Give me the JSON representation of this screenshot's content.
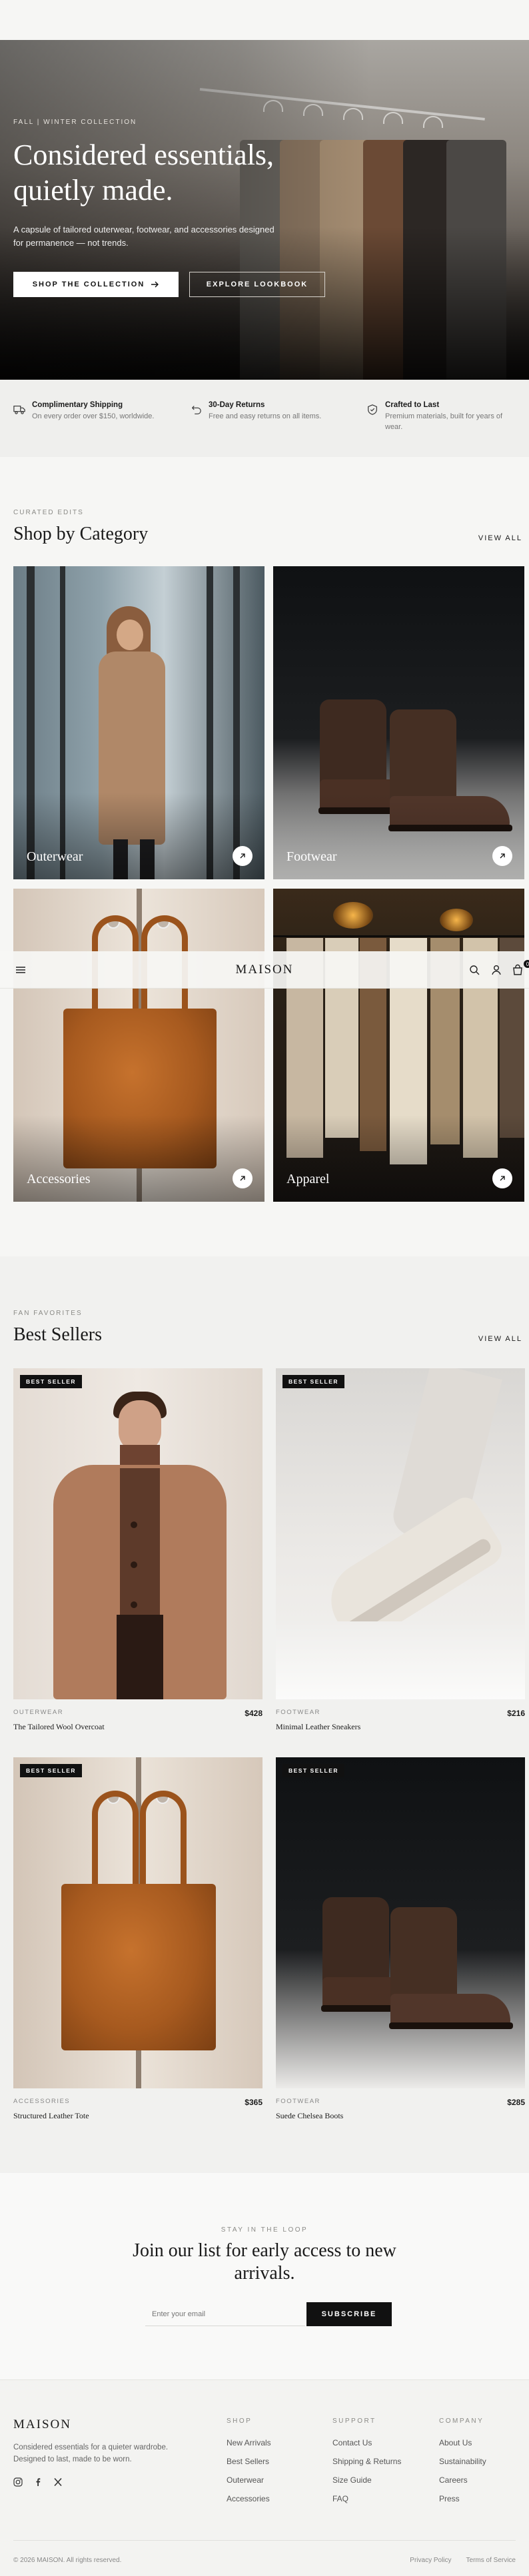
{
  "hero": {
    "eyebrow": "FALL | WINTER COLLECTION",
    "title_line1": "Considered essentials,",
    "title_line2": "quietly made.",
    "subtitle": "A capsule of tailored outerwear, footwear, and accessories designed for permanence — not trends.",
    "primary_cta": "SHOP THE COLLECTION",
    "secondary_cta": "EXPLORE LOOKBOOK"
  },
  "features": [
    {
      "title": "Complimentary Shipping",
      "text": "On every order over $150, worldwide.",
      "icon": "truck-icon"
    },
    {
      "title": "30-Day Returns",
      "text": "Free and easy returns on all items.",
      "icon": "return-icon"
    },
    {
      "title": "Crafted to Last",
      "text": "Premium materials, built for years of wear.",
      "icon": "shield-icon"
    }
  ],
  "categories_section": {
    "eyebrow": "CURATED EDITS",
    "title": "Shop by Category",
    "view_all": "VIEW ALL",
    "items": [
      {
        "label": "Outerwear"
      },
      {
        "label": "Footwear"
      },
      {
        "label": "Accessories"
      },
      {
        "label": "Apparel"
      }
    ]
  },
  "header": {
    "brand": "MAISON",
    "cart_count": "0",
    "icons": [
      "menu-icon",
      "search-icon",
      "user-icon",
      "bag-icon"
    ]
  },
  "bestsellers": {
    "eyebrow": "FAN FAVORITES",
    "title": "Best Sellers",
    "view_all": "VIEW ALL",
    "products": [
      {
        "badge": "BEST SELLER",
        "category": "OUTERWEAR",
        "name": "The Tailored Wool Overcoat",
        "price": "$428"
      },
      {
        "badge": "BEST SELLER",
        "category": "FOOTWEAR",
        "name": "Minimal Leather Sneakers",
        "price": "$216"
      },
      {
        "badge": "BEST SELLER",
        "category": "ACCESSORIES",
        "name": "Structured Leather Tote",
        "price": "$365"
      },
      {
        "badge": "BEST SELLER",
        "category": "FOOTWEAR",
        "name": "Suede Chelsea Boots",
        "price": "$285"
      }
    ]
  },
  "newsletter": {
    "eyebrow": "STAY IN THE LOOP",
    "title": "Join our list for early access to new arrivals.",
    "placeholder": "Enter your email",
    "button": "SUBSCRIBE"
  },
  "footer": {
    "brand": "MAISON",
    "tagline": "Considered essentials for a quieter wardrobe. Designed to last, made to be worn.",
    "social": [
      "instagram-icon",
      "facebook-icon",
      "x-icon"
    ],
    "columns": [
      {
        "title": "SHOP",
        "links": [
          "New Arrivals",
          "Best Sellers",
          "Outerwear",
          "Accessories"
        ]
      },
      {
        "title": "SUPPORT",
        "links": [
          "Contact Us",
          "Shipping & Returns",
          "Size Guide",
          "FAQ"
        ]
      },
      {
        "title": "COMPANY",
        "links": [
          "About Us",
          "Sustainability",
          "Careers",
          "Press"
        ]
      }
    ],
    "copyright": "© 2026 MAISON. All rights reserved.",
    "legal_links": [
      "Privacy Policy",
      "Terms of Service"
    ]
  }
}
